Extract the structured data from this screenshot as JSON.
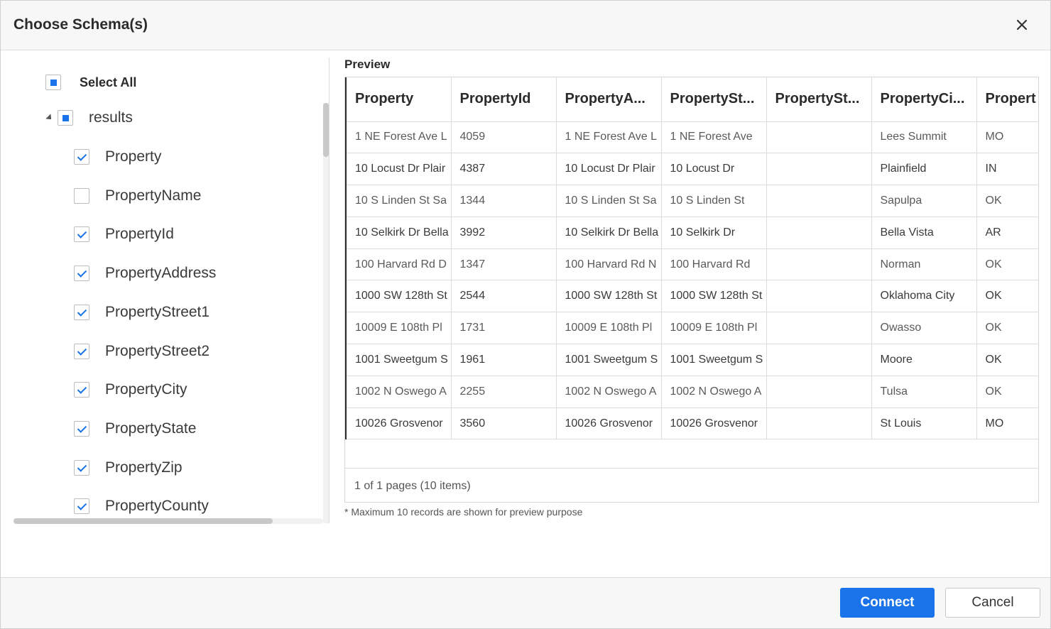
{
  "dialog": {
    "title": "Choose Schema(s)"
  },
  "tree": {
    "select_all_label": "Select All",
    "root_label": "results",
    "items": [
      {
        "label": "Property",
        "checked": true
      },
      {
        "label": "PropertyName",
        "checked": false
      },
      {
        "label": "PropertyId",
        "checked": true
      },
      {
        "label": "PropertyAddress",
        "checked": true
      },
      {
        "label": "PropertyStreet1",
        "checked": true
      },
      {
        "label": "PropertyStreet2",
        "checked": true
      },
      {
        "label": "PropertyCity",
        "checked": true
      },
      {
        "label": "PropertyState",
        "checked": true
      },
      {
        "label": "PropertyZip",
        "checked": true
      },
      {
        "label": "PropertyCounty",
        "checked": true
      }
    ]
  },
  "preview": {
    "title": "Preview",
    "columns": [
      "Property",
      "PropertyId",
      "PropertyA...",
      "PropertySt...",
      "PropertySt...",
      "PropertyCi...",
      "Propert"
    ],
    "rows": [
      [
        "1 NE Forest Ave L",
        "4059",
        "1 NE Forest Ave L",
        "1 NE Forest Ave",
        "",
        "Lees Summit",
        "MO"
      ],
      [
        "10 Locust Dr Plair",
        "4387",
        "10 Locust Dr Plair",
        "10 Locust Dr",
        "",
        "Plainfield",
        "IN"
      ],
      [
        "10 S Linden St Sa",
        "1344",
        "10 S Linden St Sa",
        "10 S Linden St",
        "",
        "Sapulpa",
        "OK"
      ],
      [
        "10 Selkirk Dr Bella",
        "3992",
        "10 Selkirk Dr Bella",
        "10 Selkirk Dr",
        "",
        "Bella Vista",
        "AR"
      ],
      [
        "100 Harvard Rd D",
        "1347",
        "100 Harvard Rd N",
        "100 Harvard Rd",
        "",
        "Norman",
        "OK"
      ],
      [
        "1000 SW 128th St",
        "2544",
        "1000 SW 128th St",
        "1000 SW 128th St",
        "",
        "Oklahoma City",
        "OK"
      ],
      [
        "10009 E 108th Pl",
        "1731",
        "10009 E 108th Pl",
        "10009 E 108th Pl",
        "",
        "Owasso",
        "OK"
      ],
      [
        "1001 Sweetgum S",
        "1961",
        "1001 Sweetgum S",
        "1001 Sweetgum S",
        "",
        "Moore",
        "OK"
      ],
      [
        "1002 N Oswego A",
        "2255",
        "1002 N Oswego A",
        "1002 N Oswego A",
        "",
        "Tulsa",
        "OK"
      ],
      [
        "10026 Grosvenor",
        "3560",
        "10026 Grosvenor",
        "10026 Grosvenor",
        "",
        "St Louis",
        "MO"
      ]
    ],
    "pager_text": "1 of 1 pages (10 items)",
    "note": "* Maximum 10 records are shown for preview purpose"
  },
  "footer": {
    "connect_label": "Connect",
    "cancel_label": "Cancel"
  },
  "colors": {
    "accent": "#1a73e8",
    "header_bg": "#f7f7f7",
    "border": "#dcdcdc"
  }
}
